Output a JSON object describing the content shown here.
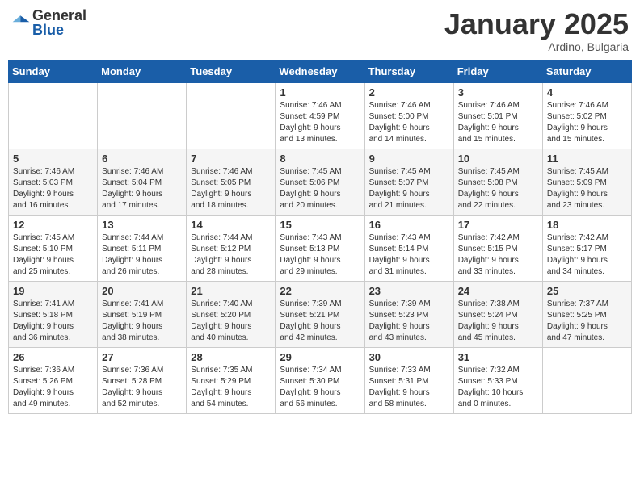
{
  "logo": {
    "general": "General",
    "blue": "Blue"
  },
  "header": {
    "month": "January 2025",
    "location": "Ardino, Bulgaria"
  },
  "weekdays": [
    "Sunday",
    "Monday",
    "Tuesday",
    "Wednesday",
    "Thursday",
    "Friday",
    "Saturday"
  ],
  "weeks": [
    [
      {
        "day": "",
        "info": ""
      },
      {
        "day": "",
        "info": ""
      },
      {
        "day": "",
        "info": ""
      },
      {
        "day": "1",
        "info": "Sunrise: 7:46 AM\nSunset: 4:59 PM\nDaylight: 9 hours\nand 13 minutes."
      },
      {
        "day": "2",
        "info": "Sunrise: 7:46 AM\nSunset: 5:00 PM\nDaylight: 9 hours\nand 14 minutes."
      },
      {
        "day": "3",
        "info": "Sunrise: 7:46 AM\nSunset: 5:01 PM\nDaylight: 9 hours\nand 15 minutes."
      },
      {
        "day": "4",
        "info": "Sunrise: 7:46 AM\nSunset: 5:02 PM\nDaylight: 9 hours\nand 15 minutes."
      }
    ],
    [
      {
        "day": "5",
        "info": "Sunrise: 7:46 AM\nSunset: 5:03 PM\nDaylight: 9 hours\nand 16 minutes."
      },
      {
        "day": "6",
        "info": "Sunrise: 7:46 AM\nSunset: 5:04 PM\nDaylight: 9 hours\nand 17 minutes."
      },
      {
        "day": "7",
        "info": "Sunrise: 7:46 AM\nSunset: 5:05 PM\nDaylight: 9 hours\nand 18 minutes."
      },
      {
        "day": "8",
        "info": "Sunrise: 7:45 AM\nSunset: 5:06 PM\nDaylight: 9 hours\nand 20 minutes."
      },
      {
        "day": "9",
        "info": "Sunrise: 7:45 AM\nSunset: 5:07 PM\nDaylight: 9 hours\nand 21 minutes."
      },
      {
        "day": "10",
        "info": "Sunrise: 7:45 AM\nSunset: 5:08 PM\nDaylight: 9 hours\nand 22 minutes."
      },
      {
        "day": "11",
        "info": "Sunrise: 7:45 AM\nSunset: 5:09 PM\nDaylight: 9 hours\nand 23 minutes."
      }
    ],
    [
      {
        "day": "12",
        "info": "Sunrise: 7:45 AM\nSunset: 5:10 PM\nDaylight: 9 hours\nand 25 minutes."
      },
      {
        "day": "13",
        "info": "Sunrise: 7:44 AM\nSunset: 5:11 PM\nDaylight: 9 hours\nand 26 minutes."
      },
      {
        "day": "14",
        "info": "Sunrise: 7:44 AM\nSunset: 5:12 PM\nDaylight: 9 hours\nand 28 minutes."
      },
      {
        "day": "15",
        "info": "Sunrise: 7:43 AM\nSunset: 5:13 PM\nDaylight: 9 hours\nand 29 minutes."
      },
      {
        "day": "16",
        "info": "Sunrise: 7:43 AM\nSunset: 5:14 PM\nDaylight: 9 hours\nand 31 minutes."
      },
      {
        "day": "17",
        "info": "Sunrise: 7:42 AM\nSunset: 5:15 PM\nDaylight: 9 hours\nand 33 minutes."
      },
      {
        "day": "18",
        "info": "Sunrise: 7:42 AM\nSunset: 5:17 PM\nDaylight: 9 hours\nand 34 minutes."
      }
    ],
    [
      {
        "day": "19",
        "info": "Sunrise: 7:41 AM\nSunset: 5:18 PM\nDaylight: 9 hours\nand 36 minutes."
      },
      {
        "day": "20",
        "info": "Sunrise: 7:41 AM\nSunset: 5:19 PM\nDaylight: 9 hours\nand 38 minutes."
      },
      {
        "day": "21",
        "info": "Sunrise: 7:40 AM\nSunset: 5:20 PM\nDaylight: 9 hours\nand 40 minutes."
      },
      {
        "day": "22",
        "info": "Sunrise: 7:39 AM\nSunset: 5:21 PM\nDaylight: 9 hours\nand 42 minutes."
      },
      {
        "day": "23",
        "info": "Sunrise: 7:39 AM\nSunset: 5:23 PM\nDaylight: 9 hours\nand 43 minutes."
      },
      {
        "day": "24",
        "info": "Sunrise: 7:38 AM\nSunset: 5:24 PM\nDaylight: 9 hours\nand 45 minutes."
      },
      {
        "day": "25",
        "info": "Sunrise: 7:37 AM\nSunset: 5:25 PM\nDaylight: 9 hours\nand 47 minutes."
      }
    ],
    [
      {
        "day": "26",
        "info": "Sunrise: 7:36 AM\nSunset: 5:26 PM\nDaylight: 9 hours\nand 49 minutes."
      },
      {
        "day": "27",
        "info": "Sunrise: 7:36 AM\nSunset: 5:28 PM\nDaylight: 9 hours\nand 52 minutes."
      },
      {
        "day": "28",
        "info": "Sunrise: 7:35 AM\nSunset: 5:29 PM\nDaylight: 9 hours\nand 54 minutes."
      },
      {
        "day": "29",
        "info": "Sunrise: 7:34 AM\nSunset: 5:30 PM\nDaylight: 9 hours\nand 56 minutes."
      },
      {
        "day": "30",
        "info": "Sunrise: 7:33 AM\nSunset: 5:31 PM\nDaylight: 9 hours\nand 58 minutes."
      },
      {
        "day": "31",
        "info": "Sunrise: 7:32 AM\nSunset: 5:33 PM\nDaylight: 10 hours\nand 0 minutes."
      },
      {
        "day": "",
        "info": ""
      }
    ]
  ]
}
